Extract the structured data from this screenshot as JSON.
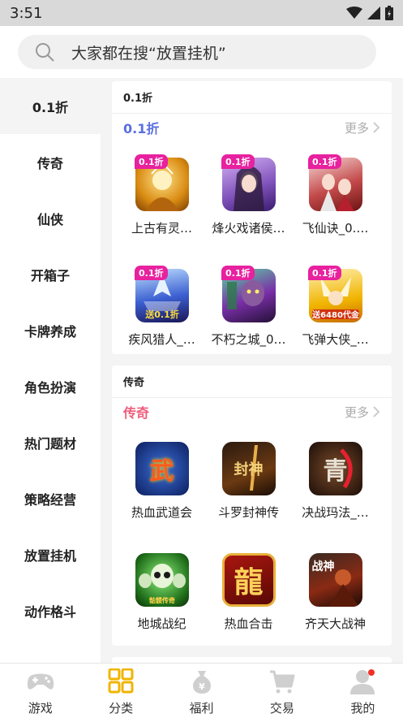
{
  "status": {
    "time": "3:51"
  },
  "search": {
    "placeholder": "大家都在搜“放置挂机”"
  },
  "sidebar": {
    "items": [
      {
        "label": "0.1折",
        "active": true
      },
      {
        "label": "传奇"
      },
      {
        "label": "仙侠"
      },
      {
        "label": "开箱子"
      },
      {
        "label": "卡牌养成"
      },
      {
        "label": "角色扮演"
      },
      {
        "label": "热门题材"
      },
      {
        "label": "策略经营"
      },
      {
        "label": "放置挂机"
      },
      {
        "label": "动作格斗"
      }
    ]
  },
  "sections": [
    {
      "title": "0.1折",
      "subtitle": "0.1折",
      "subtitle_color": "#5b6fe0",
      "more": "更多",
      "games": [
        {
          "name": "上古有灵…",
          "badge": "0.1折",
          "icon": "golden-warrior-thumb"
        },
        {
          "name": "烽火戏诸侯…",
          "badge": "0.1折",
          "icon": "princess-thumb"
        },
        {
          "name": "飞仙诀_0.…",
          "badge": "0.1折",
          "icon": "couple-thumb"
        },
        {
          "name": "疾风猎人_…",
          "badge": "0.1折",
          "icon": "ice-hunter-thumb",
          "overlay": "送0.1折"
        },
        {
          "name": "不朽之城_0…",
          "badge": "0.1折",
          "icon": "undead-thumb"
        },
        {
          "name": "飞弹大侠_…",
          "badge": "0.1折",
          "icon": "hero-thumb",
          "overlay": "送6480代金"
        }
      ]
    },
    {
      "title": "传奇",
      "subtitle": "传奇",
      "subtitle_color": "#ee5c7a",
      "more": "更多",
      "games": [
        {
          "name": "热血武道会",
          "icon": "wu-thumb",
          "glyph": "武"
        },
        {
          "name": "斗罗封神传",
          "icon": "sword-thumb",
          "glyph": "封神"
        },
        {
          "name": "决战玛法_…",
          "icon": "dragon-thumb",
          "glyph": "青"
        },
        {
          "name": "地城战纪",
          "icon": "skull-thumb",
          "overlay": "骷髅传奇"
        },
        {
          "name": "热血合击",
          "icon": "long-thumb",
          "glyph": "龍"
        },
        {
          "name": "齐天大战神",
          "icon": "warrior-thumb",
          "glyph": "战神"
        }
      ]
    }
  ],
  "tabbar": [
    {
      "label": "游戏",
      "icon": "gamepad-icon"
    },
    {
      "label": "分类",
      "icon": "grid-icon",
      "active": true
    },
    {
      "label": "福利",
      "icon": "moneybag-icon"
    },
    {
      "label": "交易",
      "icon": "cart-icon"
    },
    {
      "label": "我的",
      "icon": "user-icon",
      "notify": true
    }
  ],
  "colors": {
    "accent": "#f0b400",
    "badge": "#e8219f",
    "active_bg": "#f4f4f4"
  }
}
